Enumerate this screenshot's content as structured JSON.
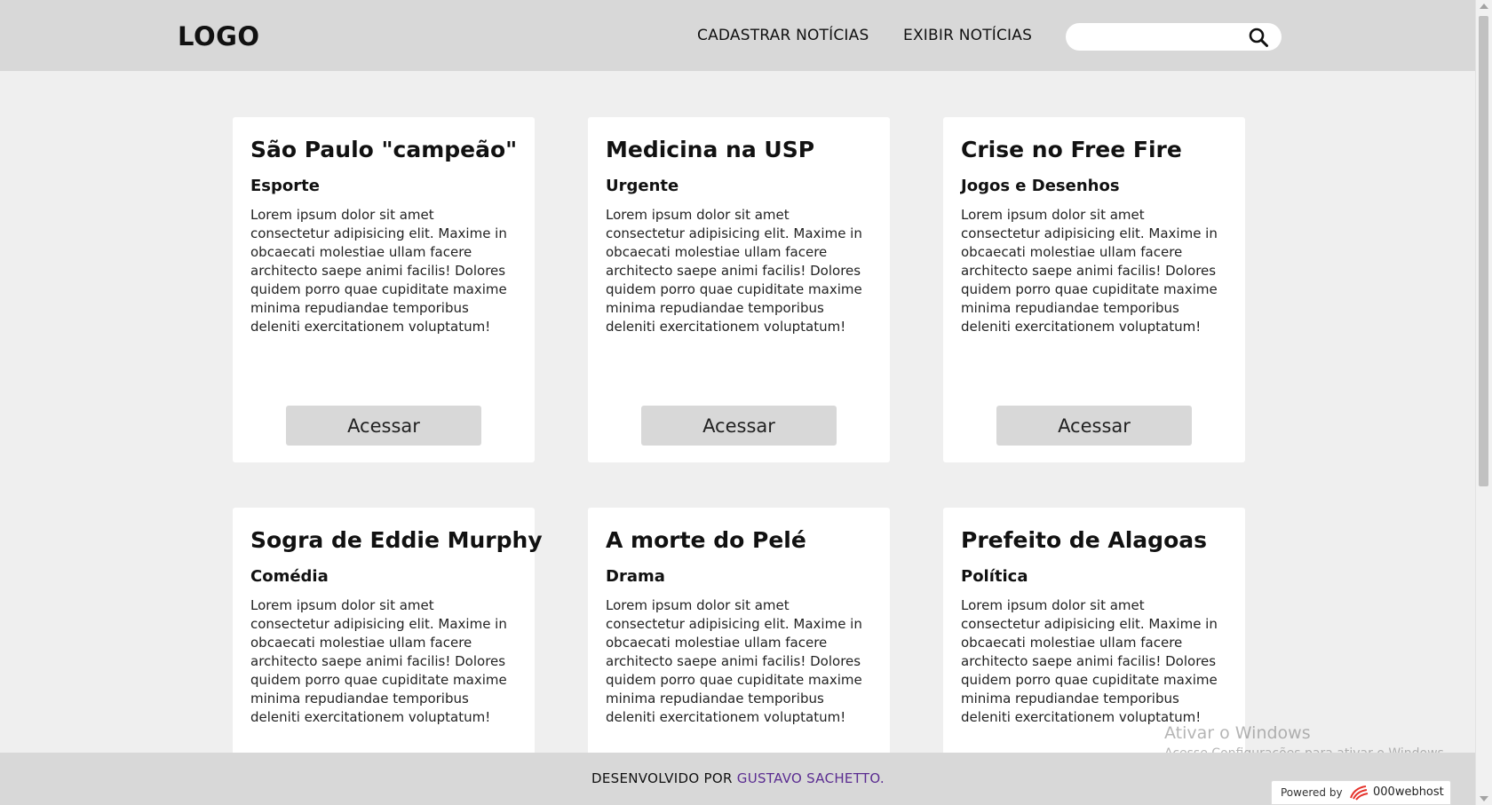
{
  "header": {
    "logo": "LOGO",
    "nav": [
      {
        "label": "CADASTRAR NOTÍCIAS"
      },
      {
        "label": "EXIBIR NOTÍCIAS"
      }
    ],
    "search": {
      "placeholder": "",
      "value": "",
      "icon": "search-icon"
    }
  },
  "cards": [
    {
      "title": "São Paulo \"campeão\"",
      "category": "Esporte",
      "text": "Lorem ipsum dolor sit amet consectetur adipisicing elit. Maxime in obcaecati molestiae ullam facere architecto saepe animi facilis! Dolores quidem porro quae cupiditate maxime minima repudiandae temporibus deleniti exercitationem voluptatum!",
      "button": "Acessar"
    },
    {
      "title": "Medicina na USP",
      "category": "Urgente",
      "text": "Lorem ipsum dolor sit amet consectetur adipisicing elit. Maxime in obcaecati molestiae ullam facere architecto saepe animi facilis! Dolores quidem porro quae cupiditate maxime minima repudiandae temporibus deleniti exercitationem voluptatum!",
      "button": "Acessar"
    },
    {
      "title": "Crise no Free Fire",
      "category": "Jogos e Desenhos",
      "text": "Lorem ipsum dolor sit amet consectetur adipisicing elit. Maxime in obcaecati molestiae ullam facere architecto saepe animi facilis! Dolores quidem porro quae cupiditate maxime minima repudiandae temporibus deleniti exercitationem voluptatum!",
      "button": "Acessar"
    },
    {
      "title": "Sogra de Eddie Murphy",
      "category": "Comédia",
      "text": "Lorem ipsum dolor sit amet consectetur adipisicing elit. Maxime in obcaecati molestiae ullam facere architecto saepe animi facilis! Dolores quidem porro quae cupiditate maxime minima repudiandae temporibus deleniti exercitationem voluptatum!"
    },
    {
      "title": "A morte do Pelé",
      "category": "Drama",
      "text": "Lorem ipsum dolor sit amet consectetur adipisicing elit. Maxime in obcaecati molestiae ullam facere architecto saepe animi facilis! Dolores quidem porro quae cupiditate maxime minima repudiandae temporibus deleniti exercitationem voluptatum!"
    },
    {
      "title": "Prefeito de Alagoas",
      "category": "Política",
      "text": "Lorem ipsum dolor sit amet consectetur adipisicing elit. Maxime in obcaecati molestiae ullam facere architecto saepe animi facilis! Dolores quidem porro quae cupiditate maxime minima repudiandae temporibus deleniti exercitationem voluptatum!"
    }
  ],
  "footer": {
    "prefix": "DESENVOLVIDO POR",
    "author": "GUSTAVO SACHETTO."
  },
  "watermark": {
    "title": "Ativar o Windows",
    "subtitle": "Acesse Configurações para ativar o Windows."
  },
  "powered_by": {
    "label": "Powered by",
    "brand": "000webhost"
  },
  "colors": {
    "header_bg": "#d8d8d8",
    "page_bg": "#efefef",
    "card_bg": "#ffffff",
    "button_bg": "#d8d8d8",
    "footer_link": "#5b2d91",
    "brand_red": "#e5322b"
  }
}
